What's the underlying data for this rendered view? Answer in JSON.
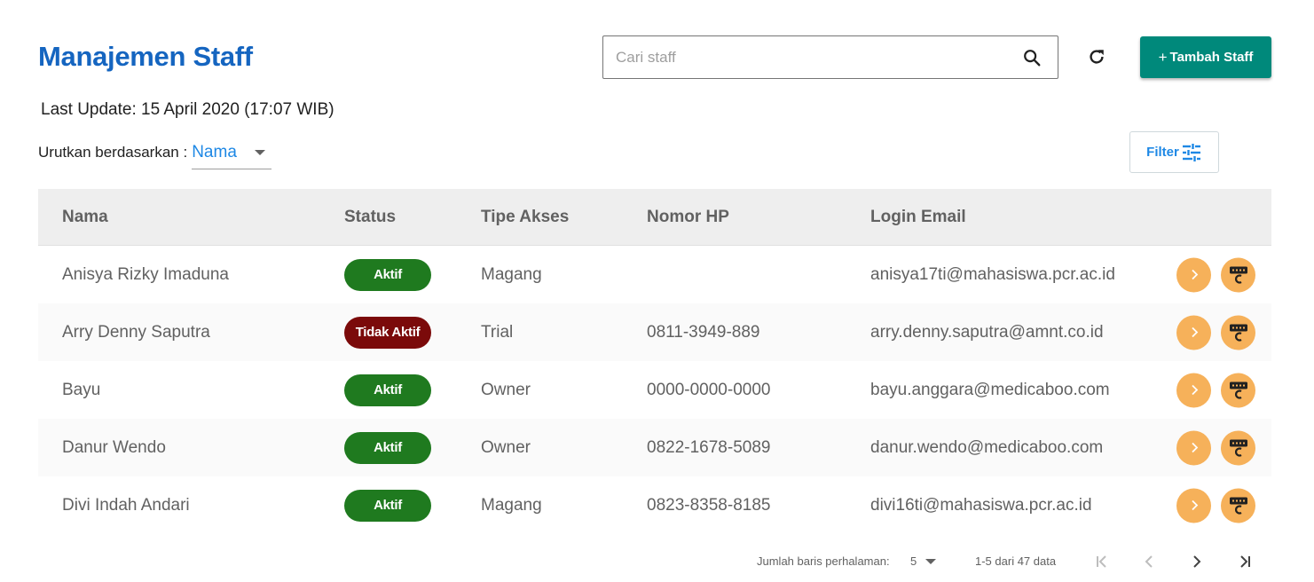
{
  "header": {
    "title": "Manajemen Staff",
    "last_update": "Last Update: 15 April 2020 (17:07 WIB)",
    "search_placeholder": "Cari staff",
    "add_button_plus": "+",
    "add_button_label": "Tambah Staff"
  },
  "sort": {
    "label": "Urutkan berdasarkan :",
    "value": "Nama"
  },
  "filter": {
    "label": "Filter"
  },
  "table": {
    "columns": [
      "Nama",
      "Status",
      "Tipe Akses",
      "Nomor HP",
      "Login Email"
    ],
    "rows": [
      {
        "nama": "Anisya Rizky Imaduna",
        "status": "Aktif",
        "tipe": "Magang",
        "hp": "",
        "email": "anisya17ti@mahasiswa.pcr.ac.id"
      },
      {
        "nama": "Arry Denny Saputra",
        "status": "Tidak Aktif",
        "tipe": "Trial",
        "hp": "0811-3949-889",
        "email": "arry.denny.saputra@amnt.co.id"
      },
      {
        "nama": "Bayu",
        "status": "Aktif",
        "tipe": "Owner",
        "hp": "0000-0000-0000",
        "email": "bayu.anggara@medicaboo.com"
      },
      {
        "nama": "Danur Wendo",
        "status": "Aktif",
        "tipe": "Owner",
        "hp": "0822-1678-5089",
        "email": "danur.wendo@medicaboo.com"
      },
      {
        "nama": "Divi Indah Andari",
        "status": "Aktif",
        "tipe": "Magang",
        "hp": "0823-8358-8185",
        "email": "divi16ti@mahasiswa.pcr.ac.id"
      }
    ]
  },
  "pagination": {
    "rows_per_page_label": "Jumlah baris perhalaman:",
    "rows_per_page": "5",
    "range": "1-5 dari 47 data"
  },
  "colors": {
    "title": "#1565c0",
    "primary_button": "#00897b",
    "accent_blue": "#1e88e5",
    "status_active": "#1f7a1f",
    "status_inactive": "#7b0a0a",
    "action_button": "#f6b15a"
  },
  "icons": {
    "search": "search-icon",
    "refresh": "refresh-icon",
    "filter": "sliders-icon",
    "row_detail": "chevron-right-icon",
    "row_card": "id-card-icon",
    "first_page": "first-page-icon",
    "prev_page": "chevron-left-icon",
    "next_page": "chevron-right-icon",
    "last_page": "last-page-icon"
  }
}
